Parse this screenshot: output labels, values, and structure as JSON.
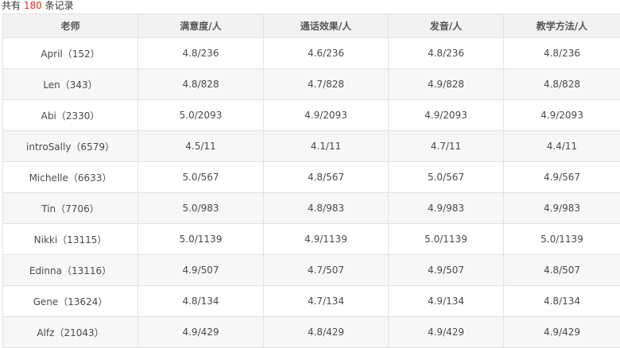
{
  "summary": {
    "prefix": "共有",
    "count": "180",
    "suffix": "条记录"
  },
  "table": {
    "headers": [
      "老师",
      "满意度/人",
      "通话效果/人",
      "发音/人",
      "教学方法/人"
    ],
    "rows": [
      [
        "April（152）",
        "4.8/236",
        "4.6/236",
        "4.8/236",
        "4.8/236"
      ],
      [
        "Len（343）",
        "4.8/828",
        "4.7/828",
        "4.9/828",
        "4.8/828"
      ],
      [
        "Abi（2330）",
        "5.0/2093",
        "4.9/2093",
        "4.9/2093",
        "4.9/2093"
      ],
      [
        "introSally（6579）",
        "4.5/11",
        "4.1/11",
        "4.7/11",
        "4.4/11"
      ],
      [
        "Michelle（6633）",
        "5.0/567",
        "4.8/567",
        "5.0/567",
        "4.9/567"
      ],
      [
        "Tin（7706）",
        "5.0/983",
        "4.8/983",
        "4.9/983",
        "4.9/983"
      ],
      [
        "Nikki（13115）",
        "5.0/1139",
        "4.9/1139",
        "5.0/1139",
        "5.0/1139"
      ],
      [
        "Edinna（13116）",
        "4.9/507",
        "4.7/507",
        "4.9/507",
        "4.8/507"
      ],
      [
        "Gene（13624）",
        "4.8/134",
        "4.7/134",
        "4.9/134",
        "4.8/134"
      ],
      [
        "Alfz（21043）",
        "4.9/429",
        "4.8/429",
        "4.9/429",
        "4.9/429"
      ]
    ]
  }
}
